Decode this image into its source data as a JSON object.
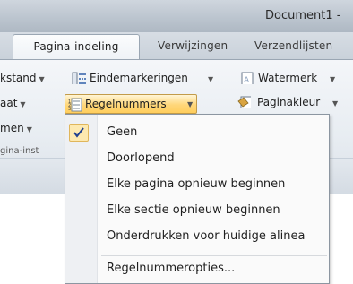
{
  "window": {
    "title": "Document1 -"
  },
  "tabs": [
    {
      "label": "Pagina-indeling",
      "active": true
    },
    {
      "label": "Verwijzingen",
      "active": false
    },
    {
      "label": "Verzendlijsten",
      "active": false
    }
  ],
  "ribbon": {
    "left_col": [
      "kstand",
      "aat",
      "men",
      "gina-inst"
    ],
    "eindemarkeringen_label": "Eindemarkeringen",
    "regelnummers_label": "Regelnummers",
    "watermerk_label": "Watermerk",
    "paginakleur_label": "Paginakleur"
  },
  "menu": {
    "items": [
      {
        "label": "Geen",
        "checked": true
      },
      {
        "label": "Doorlopend",
        "checked": false
      },
      {
        "label": "Elke pagina opnieuw beginnen",
        "checked": false
      },
      {
        "label": "Elke sectie opnieuw beginnen",
        "checked": false
      },
      {
        "label": "Onderdrukken voor huidige alinea",
        "checked": false
      }
    ],
    "options_label": "Regelnummeropties..."
  },
  "colors": {
    "highlight": "#ffd77a",
    "check": "#1f3f8f"
  }
}
